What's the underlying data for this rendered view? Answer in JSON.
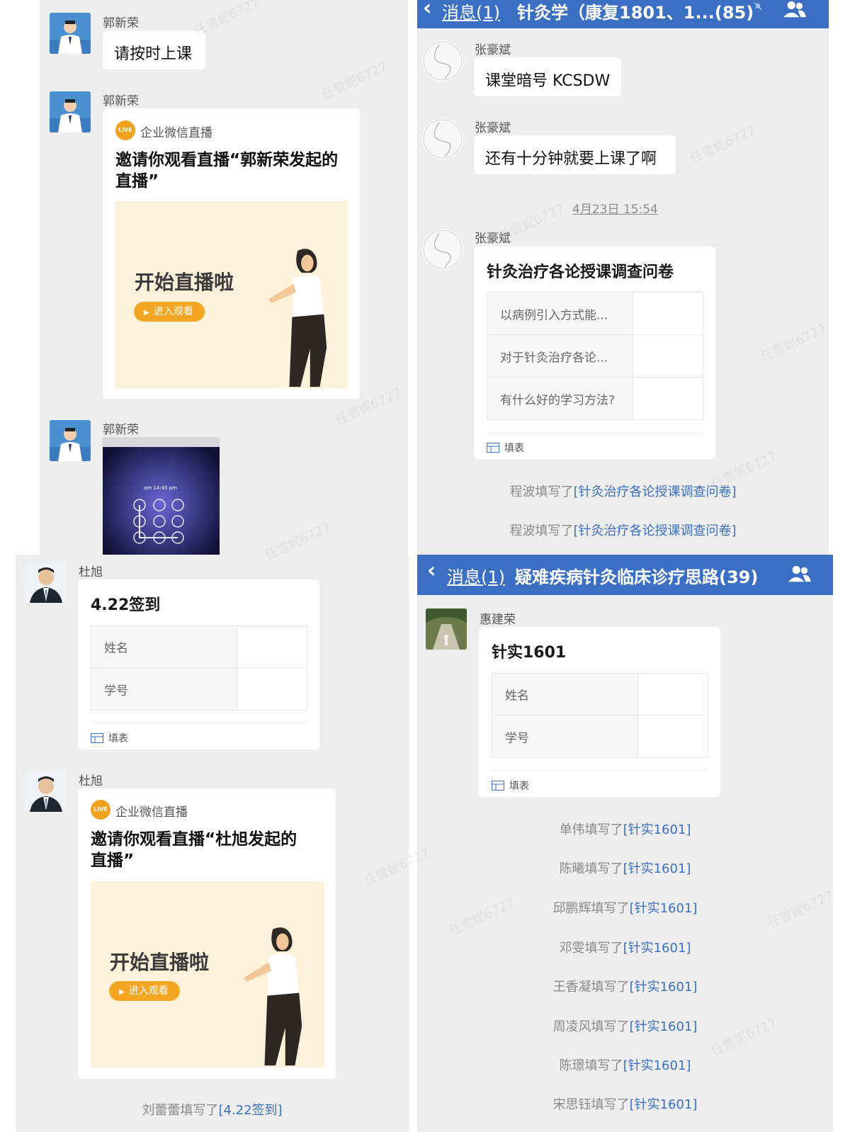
{
  "panel_a": {
    "messages": [
      {
        "sender": "郭新荣",
        "text": "请按时上课"
      },
      {
        "sender": "郭新荣",
        "live": {
          "brand": "企业微信直播",
          "badge": "LIVE",
          "title": "邀请你观看直播“郭新荣发起的直播”",
          "start_text": "开始直播啦",
          "enter_label": "进入观看"
        }
      },
      {
        "sender": "郭新荣",
        "photo": {
          "time_text": "am 14:45 pm"
        }
      }
    ]
  },
  "panel_b": {
    "nav": {
      "back_label": "消息(1)",
      "title": "针灸学（康复1801、1...(85)"
    },
    "messages": [
      {
        "sender": "张豪斌",
        "text": "课堂暗号 KCSDW"
      },
      {
        "sender": "张豪斌",
        "text": "还有十分钟就要上课了啊"
      }
    ],
    "timestamp": "4月23日 15:54",
    "form_message": {
      "sender": "张豪斌",
      "title": "针灸治疗各论授课调查问卷",
      "questions": [
        "以病例引入方式能...",
        "对于针灸治疗各论...",
        "有什么好的学习方法?"
      ],
      "footer_label": "填表"
    },
    "system_messages": [
      {
        "who": "程波",
        "verb": "填写了",
        "link": "[针灸治疗各论授课调查问卷]"
      },
      {
        "who": "程波",
        "verb": "填写了",
        "link": "[针灸治疗各论授课调查问卷]"
      }
    ]
  },
  "panel_c": {
    "form_message": {
      "sender": "杜旭",
      "title": "4.22签到",
      "questions": [
        "姓名",
        "学号"
      ],
      "footer_label": "填表"
    },
    "live_message": {
      "sender": "杜旭",
      "brand": "企业微信直播",
      "badge": "LIVE",
      "title": "邀请你观看直播“杜旭发起的直播”",
      "start_text": "开始直播啦",
      "enter_label": "进入观看"
    },
    "system_partial": {
      "who": "刘蕾蕾",
      "verb": "填写了",
      "link": "[4.22签到]"
    }
  },
  "panel_d": {
    "nav": {
      "back_label": "消息(1)",
      "title": "疑难疾病针灸临床诊疗思路(39)"
    },
    "form_message": {
      "sender": "惠建荣",
      "title": "针实1601",
      "questions": [
        "姓名",
        "学号"
      ],
      "footer_label": "填表"
    },
    "system_messages": [
      {
        "who": "单伟",
        "verb": "填写了",
        "link": "[针实1601]"
      },
      {
        "who": "陈曦",
        "verb": "填写了",
        "link": "[针实1601]"
      },
      {
        "who": "邱鹏辉",
        "verb": "填写了",
        "link": "[针实1601]"
      },
      {
        "who": "邓雯",
        "verb": "填写了",
        "link": "[针实1601]"
      },
      {
        "who": "王香凝",
        "verb": "填写了",
        "link": "[针实1601]"
      },
      {
        "who": "周凌风",
        "verb": "填写了",
        "link": "[针实1601]"
      },
      {
        "who": "陈璟",
        "verb": "填写了",
        "link": "[针实1601]"
      },
      {
        "who": "宋思钰",
        "verb": "填写了",
        "link": "[针实1601]"
      }
    ]
  },
  "watermark": "任雪妮6727",
  "colors": {
    "nav_blue": "#3a6fc4",
    "panel_bg": "#ededed",
    "live_orange": "#f4a623",
    "link_blue": "#3a6fc4"
  }
}
